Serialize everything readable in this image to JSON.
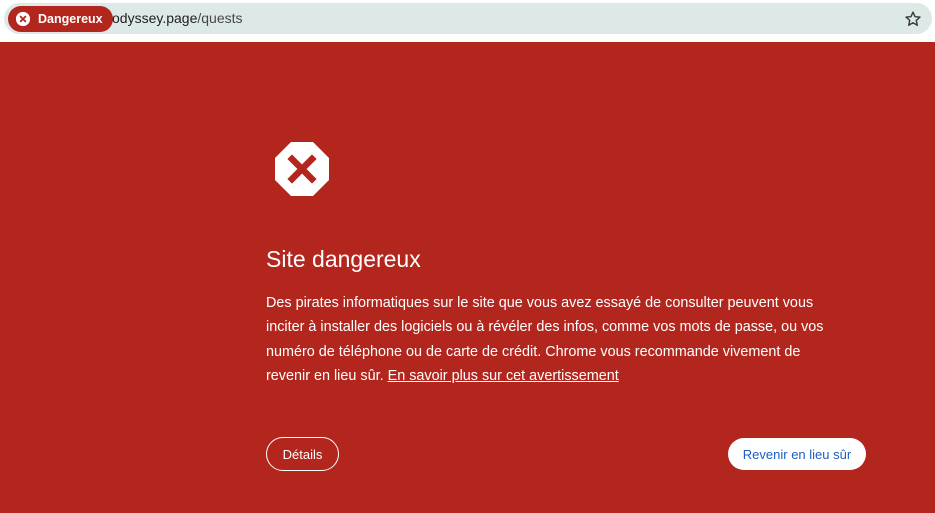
{
  "browser": {
    "security_chip_label": "Dangereux",
    "url_domain": "odyssey.page",
    "url_path": "/quests",
    "icons": [
      "danger-circle-icon",
      "bookmark-star-icon"
    ]
  },
  "interstitial": {
    "icon": "stop-octagon-icon",
    "title": "Site dangereux",
    "body": "Des pirates informatiques sur le site que vous avez essayé de consulter peuvent vous inciter à installer des logiciels ou à révéler des infos, comme vos mots de passe, ou vos numéro de téléphone ou de carte de crédit. Chrome vous recommande vivement de revenir en lieu sûr.",
    "learn_more_link": "En savoir plus sur cet avertissement",
    "details_button": "Détails",
    "back_button": "Revenir en lieu sûr"
  },
  "colors": {
    "danger_red": "#b3261e",
    "omnibox_bg": "#dce9e7",
    "link_blue": "#1a5fc4"
  }
}
